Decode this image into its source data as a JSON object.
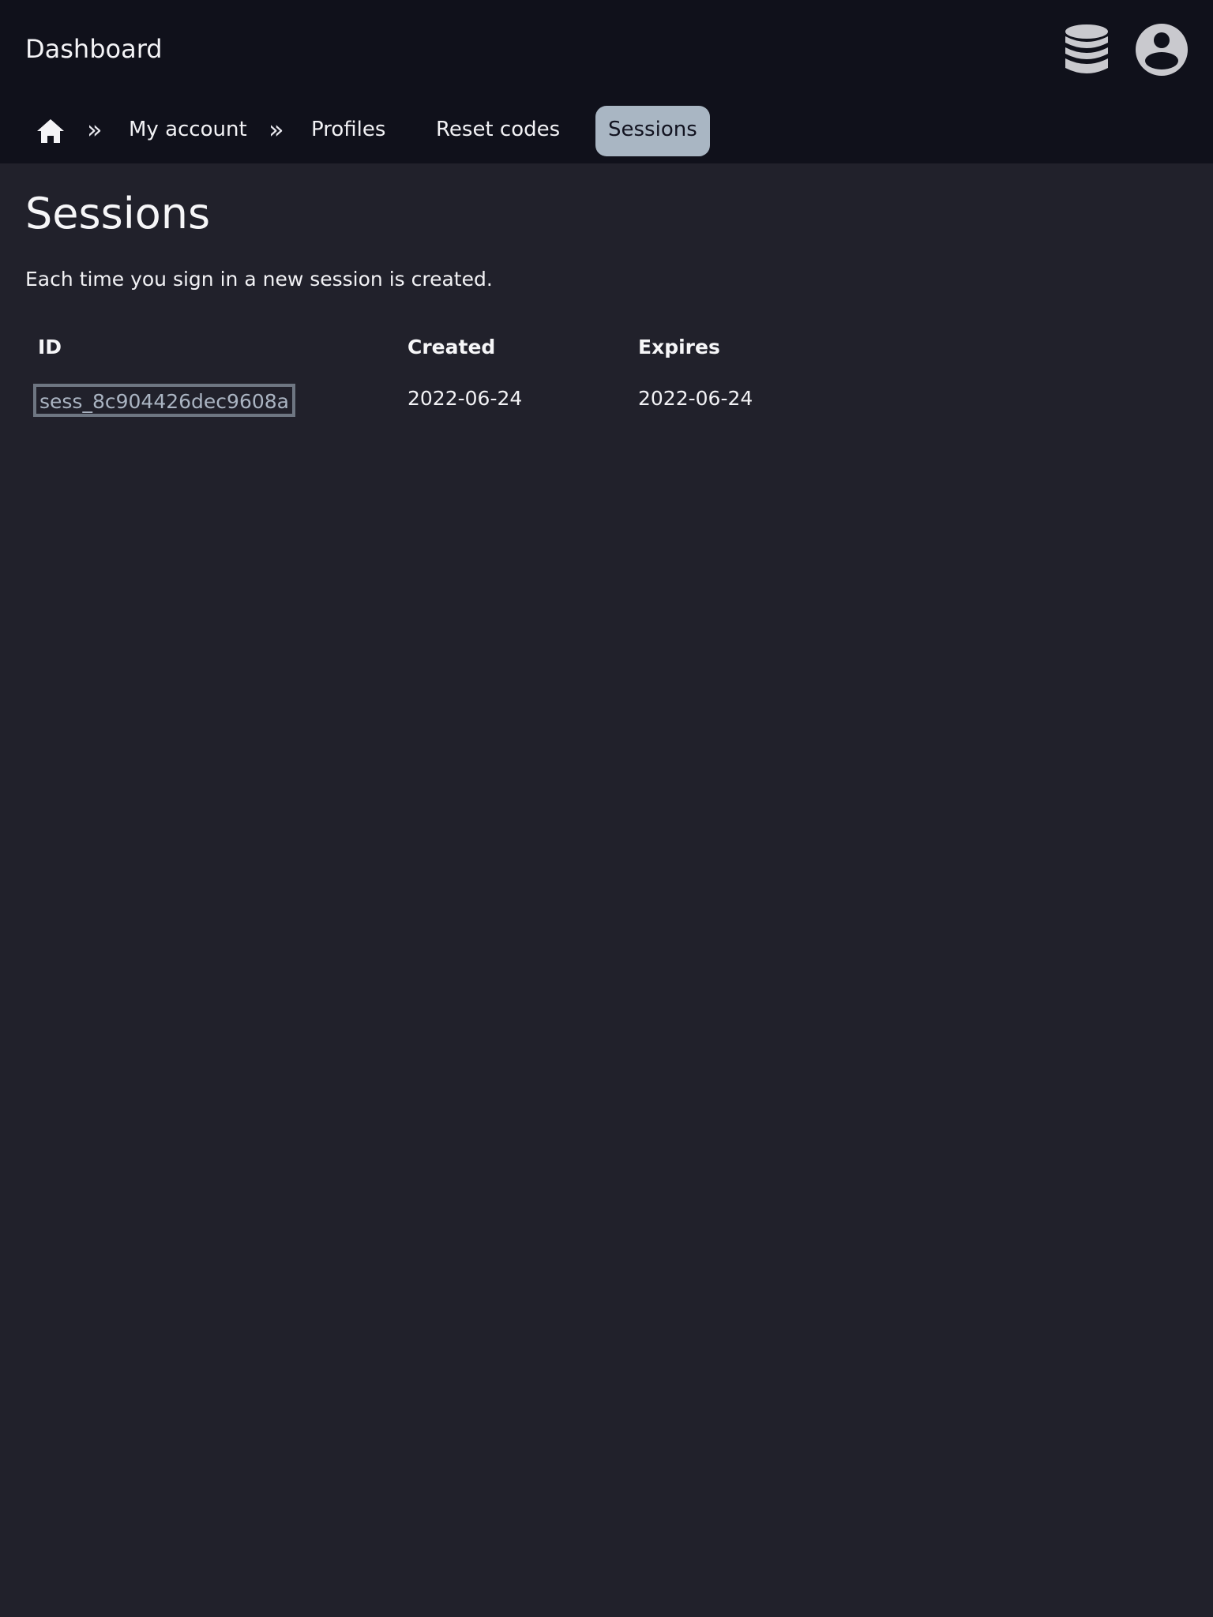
{
  "header": {
    "title": "Dashboard",
    "icons": {
      "database": "database-icon",
      "account": "user-circle-icon"
    }
  },
  "breadcrumb": {
    "home_icon": "home-icon",
    "separator": "»",
    "items": [
      {
        "label": "My account"
      },
      {
        "label": "Profiles"
      },
      {
        "label": "Reset codes"
      },
      {
        "label": "Sessions",
        "active": true
      }
    ]
  },
  "main": {
    "title": "Sessions",
    "description": "Each time you sign in a new session is created.",
    "table": {
      "headers": [
        "ID",
        "Created",
        "Expires"
      ],
      "rows": [
        [
          "sess_8c904426dec9608a",
          "2022-06-24",
          "2022-06-24"
        ]
      ]
    }
  },
  "colors": {
    "page_bg": "#21212b",
    "header_bg": "#10111b",
    "active_tab_bg": "#a9b6c3",
    "link": "#aab4c2",
    "focus_outline": "#6e7682"
  }
}
